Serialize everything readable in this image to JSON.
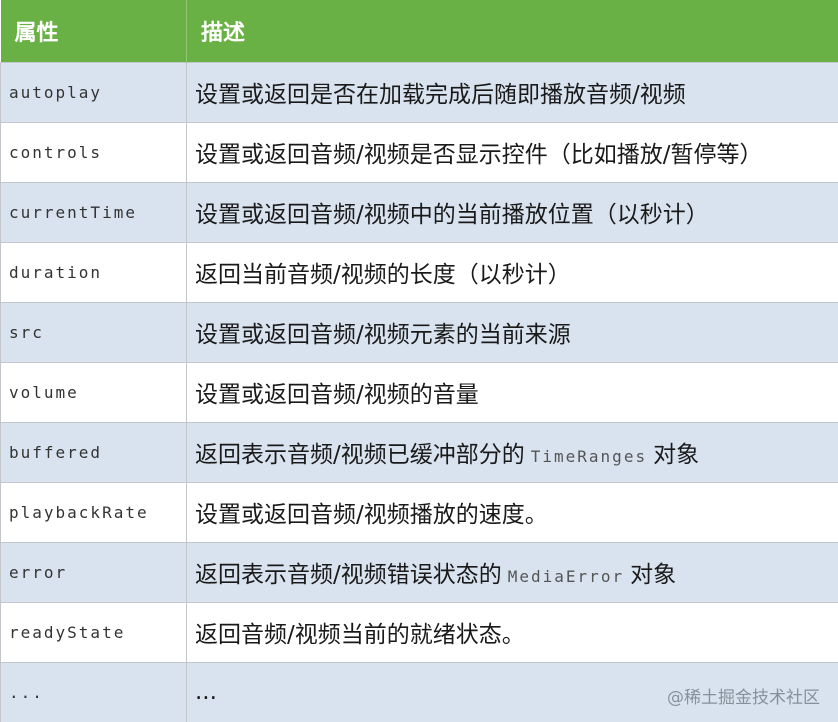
{
  "table": {
    "headers": [
      "属性",
      "描述"
    ],
    "rows": [
      {
        "prop": "autoplay",
        "desc": "设置或返回是否在加载完成后随即播放音频/视频"
      },
      {
        "prop": "controls",
        "desc": "设置或返回音频/视频是否显示控件（比如播放/暂停等）"
      },
      {
        "prop": "currentTime",
        "desc": "设置或返回音频/视频中的当前播放位置（以秒计）"
      },
      {
        "prop": "duration",
        "desc": "返回当前音频/视频的长度（以秒计）"
      },
      {
        "prop": "src",
        "desc": "设置或返回音频/视频元素的当前来源"
      },
      {
        "prop": "volume",
        "desc": "设置或返回音频/视频的音量"
      },
      {
        "prop": "buffered",
        "desc_pre": "返回表示音频/视频已缓冲部分的",
        "desc_code": "TimeRanges",
        "desc_post": "对象"
      },
      {
        "prop": "playbackRate",
        "desc": "设置或返回音频/视频播放的速度。"
      },
      {
        "prop": "error",
        "desc_pre": "返回表示音频/视频错误状态的",
        "desc_code": "MediaError",
        "desc_post": "对象"
      },
      {
        "prop": "readyState",
        "desc": "返回音频/视频当前的就绪状态。"
      },
      {
        "prop": "...",
        "desc": "..."
      }
    ]
  },
  "watermark": "@稀土掘金技术社区",
  "colors": {
    "header_bg": "#69b145",
    "row_alt_bg": "#d9e3ef",
    "row_bg": "#ffffff"
  }
}
